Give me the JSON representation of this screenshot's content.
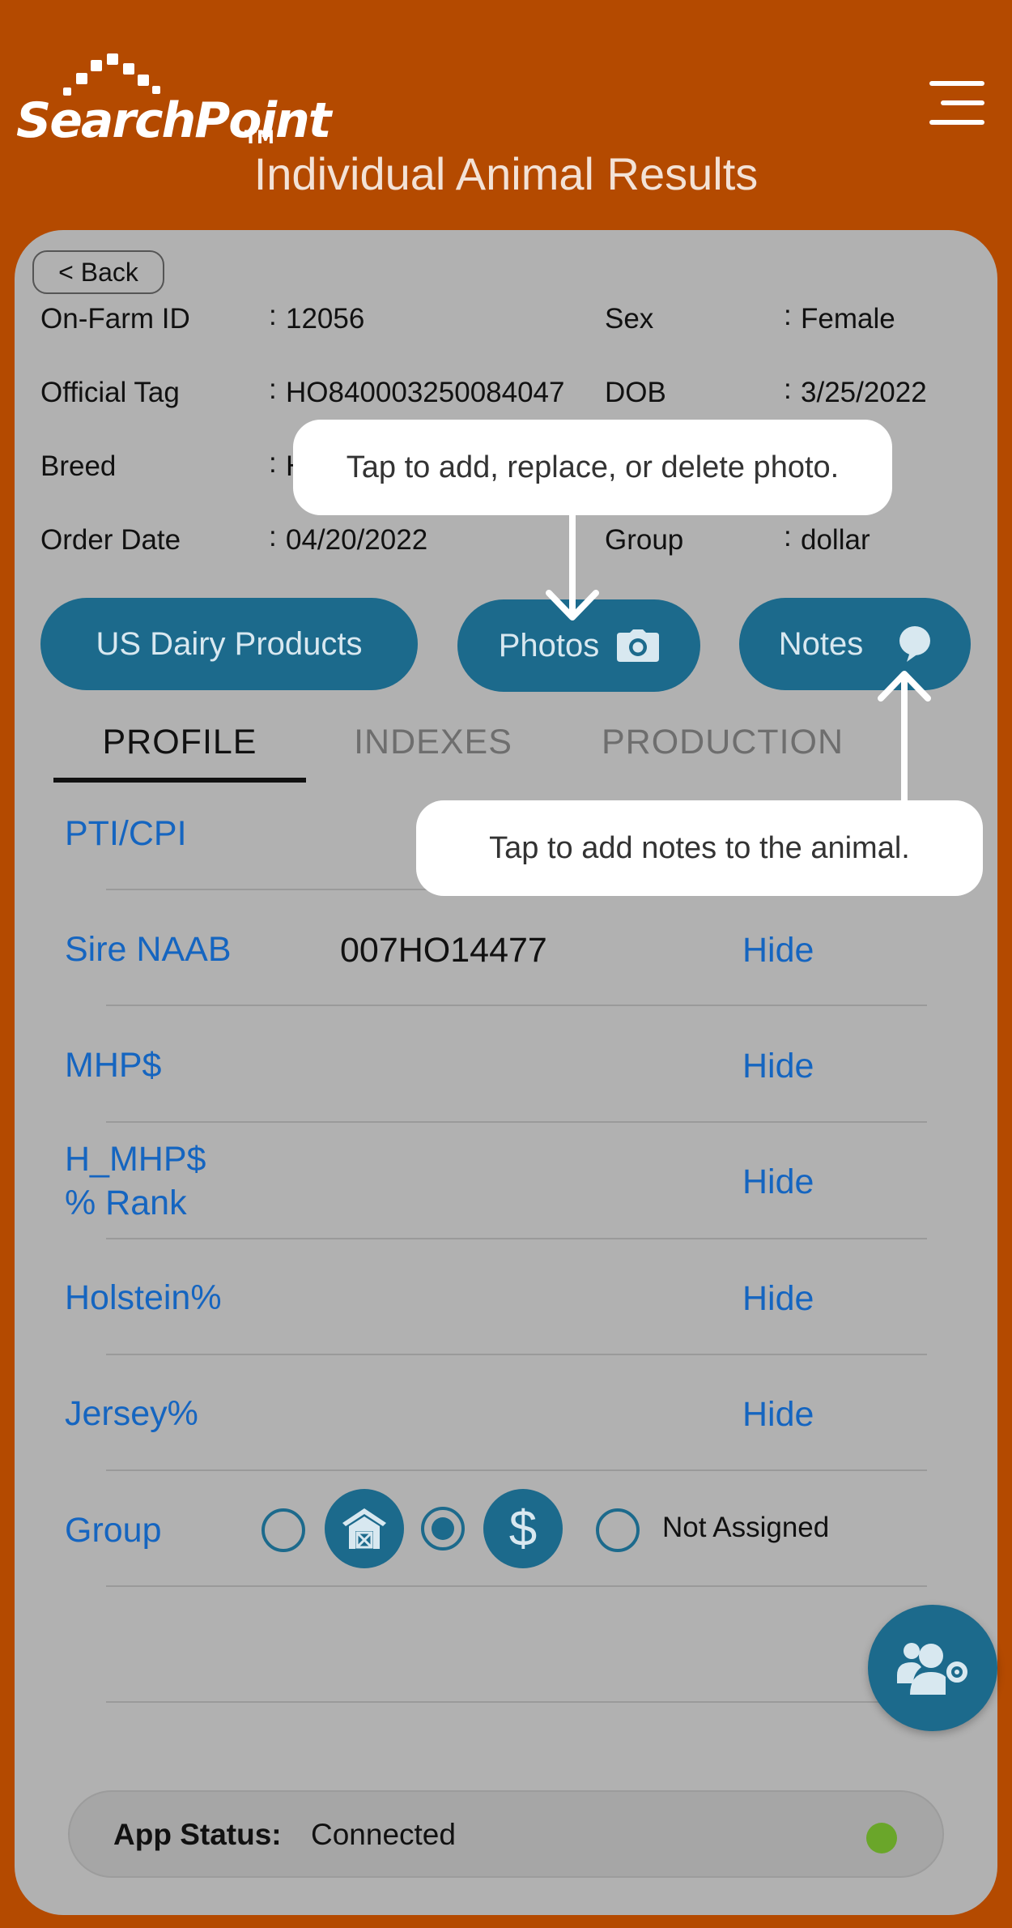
{
  "header": {
    "logo_text": "SearchPoint",
    "logo_tm": "TM",
    "title": "Individual Animal Results",
    "menu_icon": "hamburger-menu-icon"
  },
  "back_button": "< Back",
  "animal_info": {
    "on_farm_id_label": "On-Farm ID",
    "on_farm_id": "12056",
    "sex_label": "Sex",
    "sex": "Female",
    "official_tag_label": "Official Tag",
    "official_tag": "HO840003250084047",
    "dob_label": "DOB",
    "dob": "3/25/2022",
    "breed_label": "Breed",
    "breed_partial": "H",
    "order_date_label": "Order Date",
    "order_date": "04/20/2022",
    "group_label": "Group",
    "group": "dollar",
    "separator": ":"
  },
  "actions": {
    "us_dairy_products": "US Dairy Products",
    "photos": "Photos",
    "photos_icon": "camera-icon",
    "notes": "Notes",
    "notes_icon": "speech-bubble-icon"
  },
  "tabs": [
    {
      "label": "PROFILE",
      "active": true
    },
    {
      "label": "INDEXES",
      "active": false
    },
    {
      "label": "PRODUCTION",
      "active": false
    }
  ],
  "profile_rows": [
    {
      "label": "PTI/CPI",
      "value": "",
      "action": ""
    },
    {
      "label": "Sire NAAB",
      "value": "007HO14477",
      "action": "Hide"
    },
    {
      "label": "MHP$",
      "value": "",
      "action": "Hide"
    },
    {
      "label_line1": "H_MHP$",
      "label_line2": "% Rank",
      "value": "",
      "action": "Hide"
    },
    {
      "label": "Holstein%",
      "value": "",
      "action": "Hide"
    },
    {
      "label": "Jersey%",
      "value": "",
      "action": "Hide"
    }
  ],
  "group_row": {
    "label": "Group",
    "options": [
      {
        "icon": "barn-icon",
        "selected": false
      },
      {
        "icon": "dollar-icon",
        "selected": true
      },
      {
        "label": "Not Assigned",
        "selected": false
      }
    ],
    "dollar_glyph": "$"
  },
  "fab": {
    "icon": "user-settings-icon"
  },
  "status": {
    "label": "App Status:",
    "value": "Connected",
    "indicator_color": "#6aa62a"
  },
  "tooltips": {
    "photo": "Tap to add, replace, or delete photo.",
    "notes": "Tap to add notes to the animal."
  },
  "colors": {
    "brand_orange": "#b44a00",
    "accent_teal": "#1c6a8c",
    "link_blue": "#1565c0"
  }
}
